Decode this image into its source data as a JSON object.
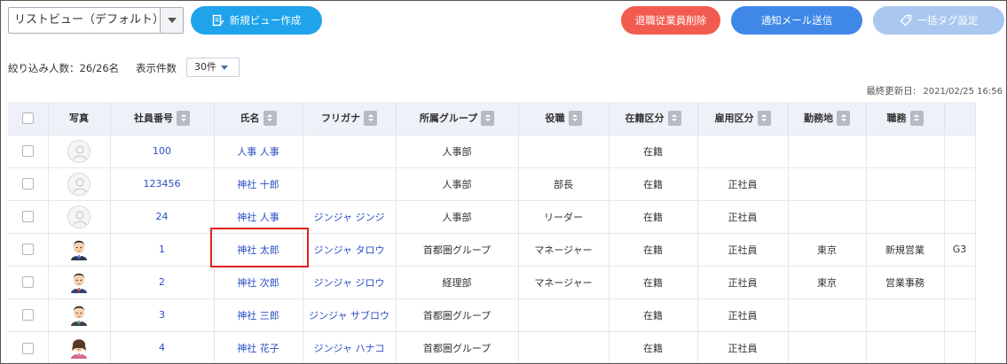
{
  "toolbar": {
    "view_select_value": "リストビュー（デフォルト）",
    "new_view_label": "新規ビュー作成",
    "delete_retired_label": "退職従業員削除",
    "send_mail_label": "通知メール送信",
    "bulk_tag_label": "一括タグ設定",
    "colors": {
      "new": "#1fa3ea",
      "delete": "#f25c50",
      "mail": "#3f88e8",
      "tag": "#a9c7ef"
    }
  },
  "filter": {
    "summary": "絞り込み人数：26/26名",
    "count_label": "表示件数",
    "count_value": "30件"
  },
  "updated": {
    "label": "最終更新日:",
    "timestamp": "2021/02/25 16:56"
  },
  "table": {
    "headers": [
      "写真",
      "社員番号",
      "氏名",
      "フリガナ",
      "所属グループ",
      "役職",
      "在籍区分",
      "雇用区分",
      "勤務地",
      "職務"
    ],
    "rows": [
      {
        "photo": "placeholder",
        "id": "100",
        "name": "人事 人事",
        "kana": "",
        "group": "人事部",
        "role": "",
        "status": "在籍",
        "employment": "",
        "location": "",
        "duty": "",
        "extra": ""
      },
      {
        "photo": "placeholder",
        "id": "123456",
        "name": "神社 十郎",
        "kana": "",
        "group": "人事部",
        "role": "部長",
        "status": "在籍",
        "employment": "正社員",
        "location": "",
        "duty": "",
        "extra": ""
      },
      {
        "photo": "placeholder",
        "id": "24",
        "name": "神社 人事",
        "kana": "ジンジャ ジンジ",
        "group": "人事部",
        "role": "リーダー",
        "status": "在籍",
        "employment": "正社員",
        "location": "",
        "duty": "",
        "extra": ""
      },
      {
        "photo": "man-a",
        "id": "1",
        "name": "神社 太郎",
        "kana": "ジンジャ タロウ",
        "group": "首都圏グループ",
        "role": "マネージャー",
        "status": "在籍",
        "employment": "正社員",
        "location": "東京",
        "duty": "新規営業",
        "extra": "G3"
      },
      {
        "photo": "man-b",
        "id": "2",
        "name": "神社 次郎",
        "kana": "ジンジャ ジロウ",
        "group": "経理部",
        "role": "マネージャー",
        "status": "在籍",
        "employment": "正社員",
        "location": "東京",
        "duty": "営業事務",
        "extra": ""
      },
      {
        "photo": "man-c",
        "id": "3",
        "name": "神社 三郎",
        "kana": "ジンジャ サブロウ",
        "group": "首都圏グループ",
        "role": "",
        "status": "在籍",
        "employment": "正社員",
        "location": "",
        "duty": "",
        "extra": ""
      },
      {
        "photo": "woman-a",
        "id": "4",
        "name": "神社 花子",
        "kana": "ジンジャ ハナコ",
        "group": "首都圏グループ",
        "role": "",
        "status": "在籍",
        "employment": "正社員",
        "location": "",
        "duty": "",
        "extra": ""
      }
    ]
  },
  "highlight": {
    "row": 3,
    "column": "name",
    "color": "#e0201c"
  }
}
